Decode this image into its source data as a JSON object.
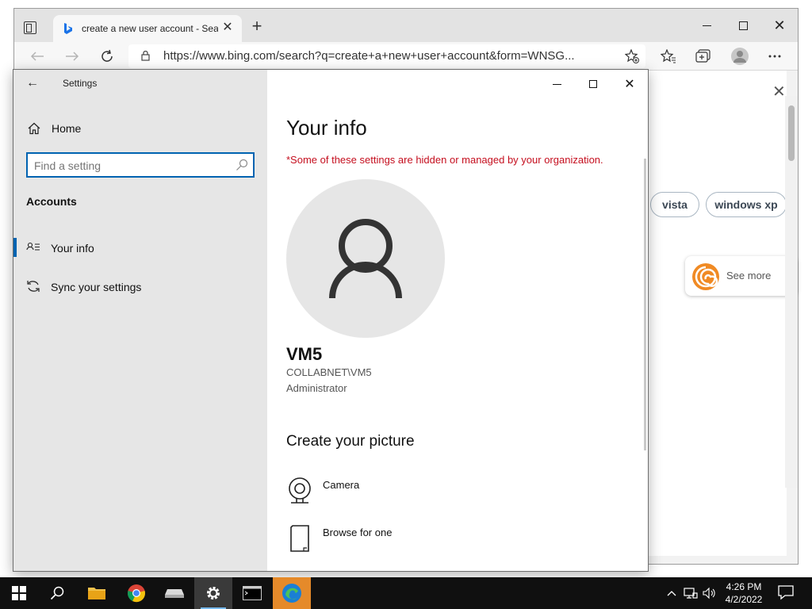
{
  "browser": {
    "tab_title": "create a new user account - Sear",
    "tab_close": "✕",
    "new_tab": "+",
    "address": "https://www.bing.com/search?q=create+a+new+user+account&form=WNSG...",
    "window_controls": {
      "minimize": "",
      "maximize": "",
      "close": "✕"
    }
  },
  "bing": {
    "close": "✕",
    "pills": [
      "vista",
      "windows xp"
    ],
    "see_more": "See more"
  },
  "settings": {
    "app_title": "Settings",
    "back": "←",
    "home_label": "Home",
    "search_placeholder": "Find a setting",
    "section": "Accounts",
    "nav": [
      {
        "label": "Your info",
        "icon": "person-card-icon",
        "selected": true
      },
      {
        "label": "Sync your settings",
        "icon": "sync-icon",
        "selected": false
      }
    ],
    "window_controls": {
      "close": "✕"
    },
    "page": {
      "title": "Your info",
      "org_note": "*Some of these settings are hidden or managed by your organization.",
      "user_name": "VM5",
      "user_domain": "COLLABNET\\VM5",
      "user_role": "Administrator",
      "picture_heading": "Create your picture",
      "options": [
        {
          "label": "Camera",
          "icon": "camera-icon"
        },
        {
          "label": "Browse for one",
          "icon": "browse-file-icon"
        }
      ]
    }
  },
  "taskbar": {
    "apps": [
      "start-icon",
      "search-icon",
      "file-explorer-icon",
      "chrome-icon",
      "drive-icon",
      "settings-icon",
      "terminal-icon",
      "edge-icon"
    ],
    "time": "4:26 PM",
    "date": "4/2/2022"
  },
  "colors": {
    "accent": "#0063b1",
    "warning_text": "#c50f1f",
    "taskbar": "#101010"
  }
}
